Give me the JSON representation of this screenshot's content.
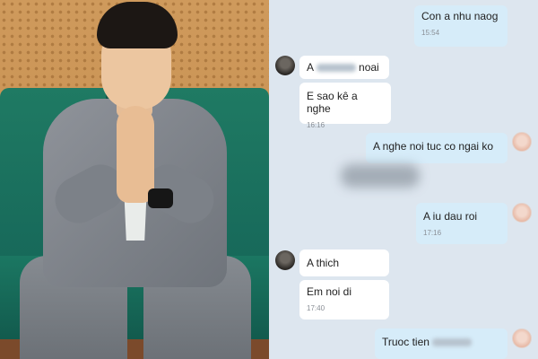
{
  "messages": [
    {
      "text": "Con a nhu naog",
      "time": "15:54"
    },
    {
      "text": "A",
      "suffix": "noai"
    },
    {
      "text": "E sao kê a nghe",
      "time": "16:16"
    },
    {
      "text": "A nghe noi tuc co ngai ko"
    },
    {
      "text": "A iu dau roi",
      "time": "17:16"
    },
    {
      "text": "A thich"
    },
    {
      "text": "Em noi di",
      "time": "17:40"
    },
    {
      "text": "Truoc tien"
    }
  ],
  "colors": {
    "chat_background": "#dde6ef",
    "incoming_bubble": "#ffffff",
    "outgoing_bubble": "#d6ecf9",
    "sofa": "#1b7762"
  }
}
